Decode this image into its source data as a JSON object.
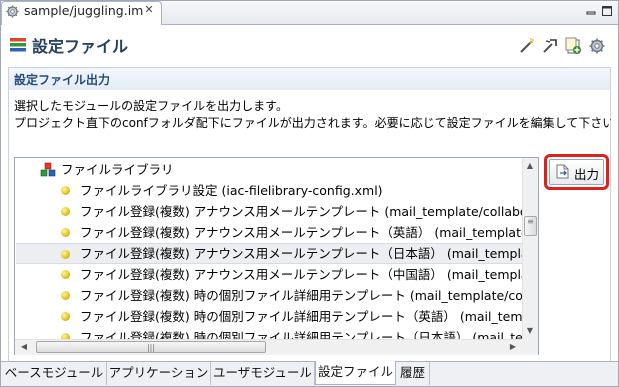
{
  "editor_tab": {
    "title": "sample/juggling.im",
    "close_glyph": "✕"
  },
  "header": {
    "title": "設定ファイル"
  },
  "section": {
    "title": "設定ファイル出力",
    "description": [
      "選択したモジュールの設定ファイルを出力します。",
      "プロジェクト直下のconfフォルダ配下にファイルが出力されます。必要に応じて設定ファイルを編集して下さい"
    ]
  },
  "tree": {
    "root_label": "ファイルライブラリ",
    "items": [
      "ファイルライブラリ設定 (iac-filelibrary-config.xml)",
      "ファイル登録(複数) アナウンス用メールテンプレート (mail_template/collaboration",
      "ファイル登録(複数) アナウンス用メールテンプレート（英語） (mail_template/file",
      "ファイル登録(複数) アナウンス用メールテンプレート（日本語） (mail_template/",
      "ファイル登録(複数) アナウンス用メールテンプレート（中国語） (mail_template/",
      "ファイル登録(複数) 時の個別ファイル詳細用テンプレート (mail_template/collabo",
      "ファイル登録(複数) 時の個別ファイル詳細用テンプレート（英語） (mail_templat",
      "ファイル登録(複数) 時の個別ファイル詳細用テンプレート（日本語） (mail_temp"
    ],
    "selected_index": 3
  },
  "output_button": {
    "label": "出力"
  },
  "bottom_tabs": [
    "ベースモジュール",
    "アプリケーション",
    "ユーザモジュール",
    "設定ファイル",
    "履歴"
  ],
  "active_bottom_tab": "設定ファイル",
  "scrollbar_glyphs": {
    "up": "▲",
    "down": "▼",
    "left": "◀",
    "right": "▶",
    "grip_v": "≡",
    "grip_h": "|||"
  },
  "colors": {
    "title": "#26405e",
    "section_title": "#264d7a",
    "highlight_ring": "#e0201b"
  }
}
